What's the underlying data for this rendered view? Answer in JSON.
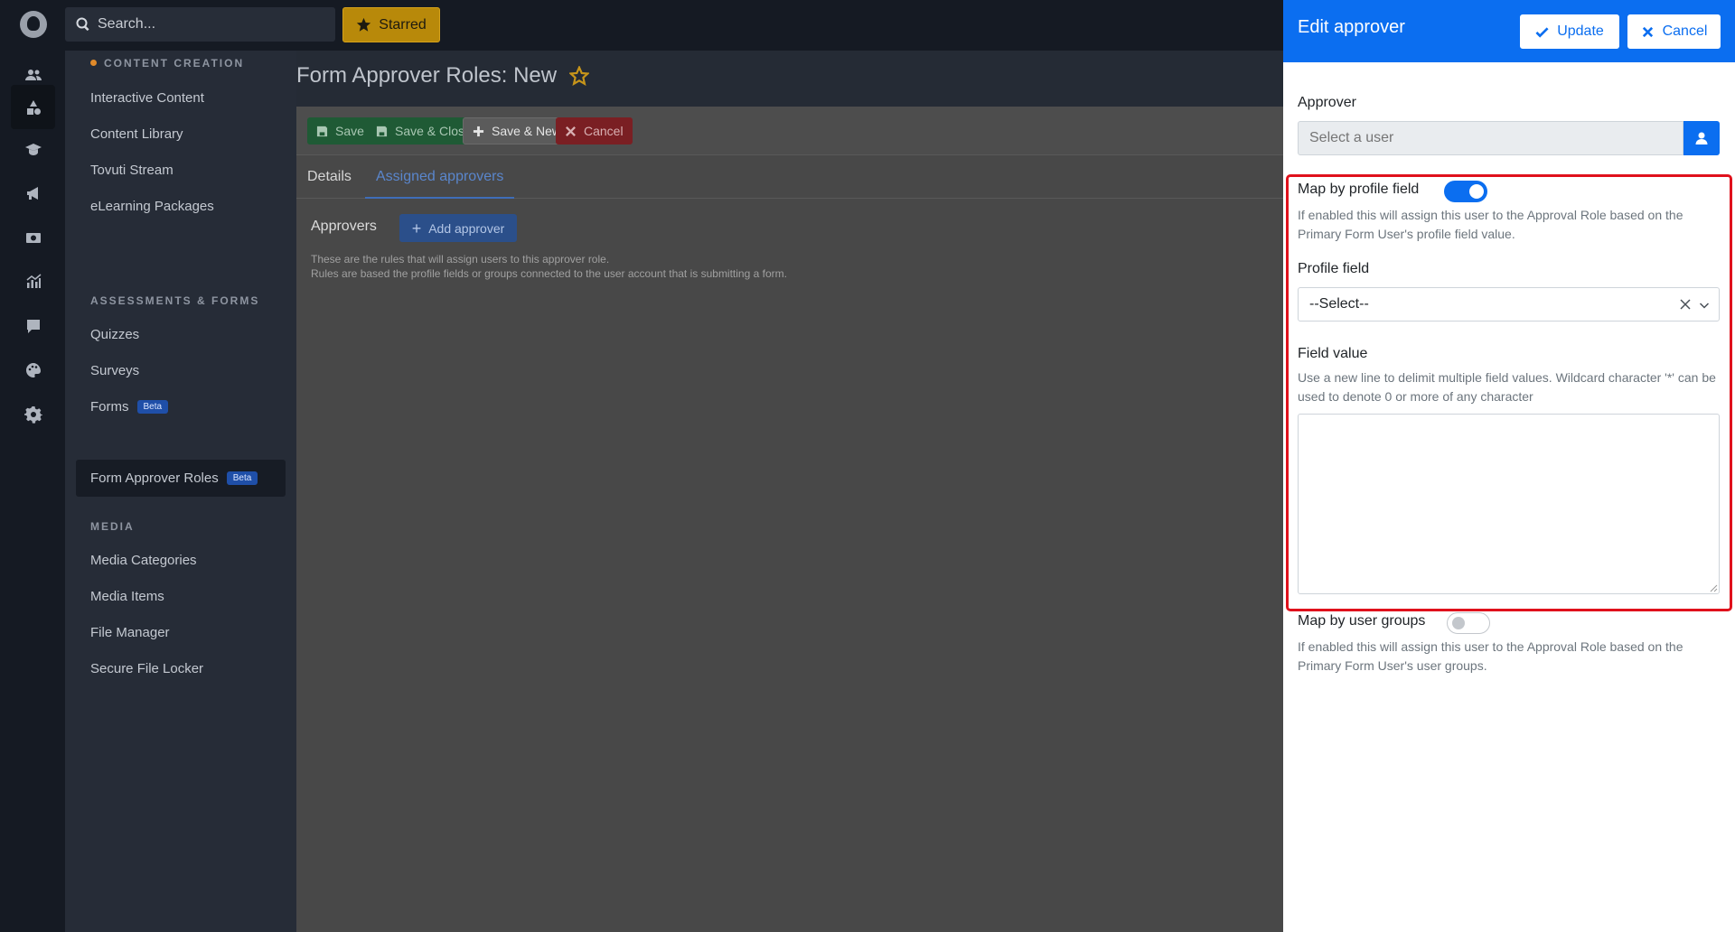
{
  "rail": {
    "icons": [
      "logo-icon",
      "users-icon",
      "shapes-icon",
      "graduation-cap-icon",
      "megaphone-icon",
      "video-icon",
      "chart-icon",
      "comment-icon",
      "palette-icon",
      "gear-icon"
    ],
    "active_index": 2
  },
  "topbar": {
    "search_placeholder": "Search...",
    "starred_label": "Starred"
  },
  "subnav": {
    "sections": [
      {
        "title": "CONTENT CREATION",
        "items": [
          "Interactive Content",
          "Content Library",
          "Tovuti Stream",
          "eLearning Packages"
        ]
      },
      {
        "title": "ASSESSMENTS & FORMS",
        "items": [
          "Quizzes",
          "Surveys",
          "Forms",
          "Form Approver Roles"
        ]
      },
      {
        "title": "MEDIA",
        "items": [
          "Media Categories",
          "Media Items",
          "File Manager",
          "Secure File Locker"
        ]
      }
    ],
    "beta_label": "Beta",
    "active_item": "Form Approver Roles"
  },
  "main": {
    "page_title": "Form Approver Roles: New",
    "toolbar": {
      "save": "Save",
      "save_close": "Save & Close",
      "save_new": "Save & New",
      "cancel": "Cancel"
    },
    "tabs": [
      "Details",
      "Assigned approvers"
    ],
    "active_tab": "Assigned approvers",
    "approvers_label": "Approvers",
    "add_approver": "Add approver",
    "help_line1": "These are the rules that will assign users to this approver role.",
    "help_line2": "Rules are based the profile fields or groups connected to the user account that is submitting a form."
  },
  "panel": {
    "title": "Edit approver",
    "update": "Update",
    "cancel": "Cancel",
    "approver_label": "Approver",
    "approver_placeholder": "Select a user",
    "map_profile_label": "Map by profile field",
    "map_profile_enabled": true,
    "map_profile_hint": "If enabled this will assign this user to the Approval Role based on the Primary Form User's profile field value.",
    "profile_field_label": "Profile field",
    "profile_field_value": "--Select--",
    "field_value_label": "Field value",
    "field_value_hint": "Use a new line to delimit multiple field values. Wildcard character '*' can be used to denote 0 or more of any character",
    "field_value_text": "",
    "map_groups_label": "Map by user groups",
    "map_groups_enabled": false,
    "map_groups_hint": "If enabled this will assign this user to the Approval Role based on the Primary Form User's user groups."
  },
  "colors": {
    "panel_header": "#0b6ef0",
    "highlight_border": "#e0111c",
    "starred_bg": "#b8890a"
  }
}
